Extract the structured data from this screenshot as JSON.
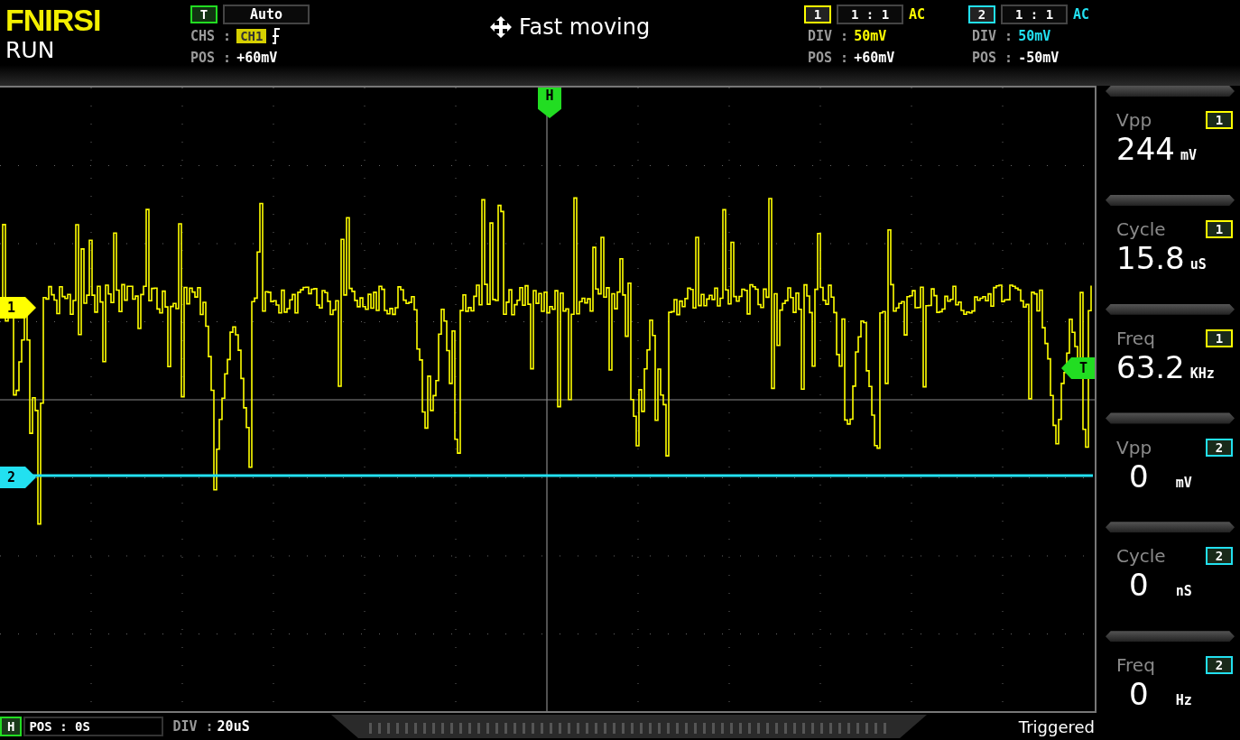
{
  "brand": "FNIRSI",
  "run_state": "RUN",
  "trigger": {
    "label": "T",
    "mode": "Auto",
    "source_label": "CHS :",
    "source": "CH1",
    "pos_label": "POS :",
    "pos": "+60mV"
  },
  "hint": "Fast moving",
  "channels": [
    {
      "label": "1",
      "probe": "1 : 1",
      "coupling": "AC",
      "div_label": "DIV :",
      "div": "50mV",
      "pos_label": "POS :",
      "pos": "+60mV",
      "color": "#ffff00"
    },
    {
      "label": "2",
      "probe": "1 : 1",
      "coupling": "AC",
      "div_label": "DIV :",
      "div": "50mV",
      "pos_label": "POS :",
      "pos": "-50mV",
      "color": "#22e0f0"
    }
  ],
  "plot": {
    "markers": [
      {
        "kind": "channel",
        "label": "1",
        "color": "#ffff00"
      },
      {
        "kind": "channel",
        "label": "2",
        "color": "#22e0f0"
      },
      {
        "kind": "horizontal",
        "label": "H",
        "color": "#22dd22"
      },
      {
        "kind": "trigger",
        "label": "T",
        "color": "#22dd22"
      }
    ]
  },
  "measurements": [
    {
      "name": "Vpp",
      "channel": "1",
      "value": "244",
      "unit": "mV",
      "color": "#ffff00"
    },
    {
      "name": "Cycle",
      "channel": "1",
      "value": "15.8",
      "unit": "uS",
      "color": "#ffff00"
    },
    {
      "name": "Freq",
      "channel": "1",
      "value": "63.2",
      "unit": "KHz",
      "color": "#ffff00"
    },
    {
      "name": "Vpp",
      "channel": "2",
      "value": "0",
      "unit": "mV",
      "color": "#22e0f0"
    },
    {
      "name": "Cycle",
      "channel": "2",
      "value": "0",
      "unit": "nS",
      "color": "#22e0f0"
    },
    {
      "name": "Freq",
      "channel": "2",
      "value": "0",
      "unit": "Hz",
      "color": "#22e0f0"
    }
  ],
  "status_bar": {
    "h_label": "H",
    "pos": "POS : 0S",
    "div_label": "DIV :",
    "div": "20uS",
    "status": "Triggered"
  }
}
